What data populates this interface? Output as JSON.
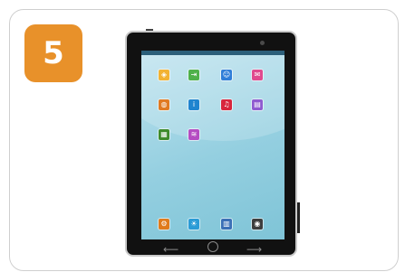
{
  "step": {
    "number": "5"
  },
  "tablet": {
    "apps": [
      {
        "name": "maps-app-icon",
        "color": "#f2b233",
        "glyph": "◈"
      },
      {
        "name": "exit-app-icon",
        "color": "#4fb14a",
        "glyph": "⇥"
      },
      {
        "name": "contacts-app-icon",
        "color": "#2f7ed8",
        "glyph": "☺"
      },
      {
        "name": "mail-app-icon",
        "color": "#e04a8e",
        "glyph": "✉"
      },
      {
        "name": "browser-app-icon",
        "color": "#e07a23",
        "glyph": "◍"
      },
      {
        "name": "info-app-icon",
        "color": "#1f84cf",
        "glyph": "i"
      },
      {
        "name": "music-app-icon",
        "color": "#d8263d",
        "glyph": "♫"
      },
      {
        "name": "keyboard-app-icon",
        "color": "#8f5bd0",
        "glyph": "▤"
      },
      {
        "name": "news-app-icon",
        "color": "#3e8b2b",
        "glyph": "▦"
      },
      {
        "name": "wifi-app-icon",
        "color": "#b54cc2",
        "glyph": "≋"
      }
    ],
    "dock": [
      {
        "name": "settings-app-icon",
        "color": "#e07b1c",
        "glyph": "⚙"
      },
      {
        "name": "weather-app-icon",
        "color": "#2a9bd6",
        "glyph": "☀"
      },
      {
        "name": "calendar-app-icon",
        "color": "#3b6fb6",
        "glyph": "▥"
      },
      {
        "name": "camera-app-icon",
        "color": "#3d3d3d",
        "glyph": "◉"
      }
    ]
  }
}
